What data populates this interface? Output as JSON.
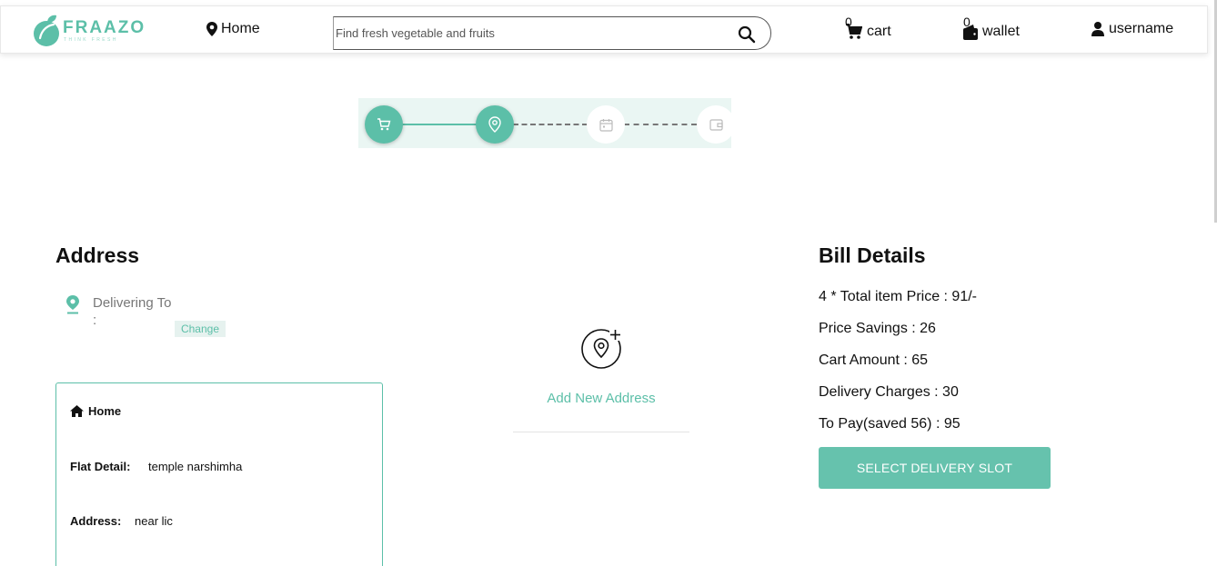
{
  "header": {
    "logo": {
      "name": "FRAAZO",
      "tagline": "THINK FRESH"
    },
    "home_label": "Home",
    "search": {
      "placeholder": "Find fresh vegetable and fruits"
    },
    "cart": {
      "count": "0",
      "label": "cart"
    },
    "wallet": {
      "count": "0",
      "label": "wallet"
    },
    "user": {
      "label": "username"
    }
  },
  "stepper": {
    "steps": [
      {
        "icon": "cart-icon",
        "state": "complete"
      },
      {
        "icon": "location-pin-icon",
        "state": "active"
      },
      {
        "icon": "calendar-icon",
        "state": "inactive"
      },
      {
        "icon": "wallet-icon",
        "state": "inactive"
      }
    ]
  },
  "address": {
    "title": "Address",
    "delivering_to": "Delivering To :",
    "change_label": "Change",
    "card": {
      "type": "Home",
      "flat_key": "Flat Detail:",
      "flat_value": "temple narshimha",
      "address_key": "Address:",
      "address_value": "near lic"
    },
    "add_new_label": "Add New Address"
  },
  "bill": {
    "title": "Bill Details",
    "lines": [
      "4 * Total item Price : 91/-",
      "Price Savings : 26",
      "Cart Amount : 65",
      "Delivery Charges : 30",
      "To Pay(saved 56) : 95"
    ],
    "cta_label": "SELECT DELIVERY SLOT"
  },
  "colors": {
    "accent": "#5cbfa8",
    "accent_light": "#eaf6f3",
    "button": "#66c2ad"
  }
}
